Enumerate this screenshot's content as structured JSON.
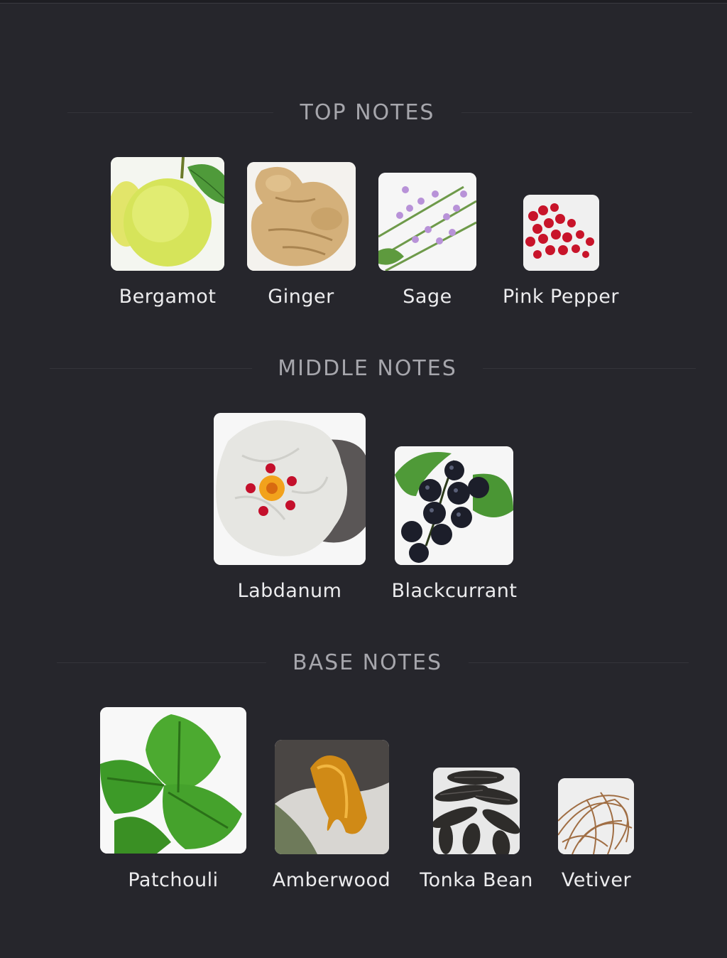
{
  "sections": {
    "top": {
      "title": "TOP NOTES",
      "items": [
        {
          "label": "Bergamot",
          "icon": "bergamot-icon"
        },
        {
          "label": "Ginger",
          "icon": "ginger-icon"
        },
        {
          "label": "Sage",
          "icon": "sage-icon"
        },
        {
          "label": "Pink Pepper",
          "icon": "pink-pepper-icon"
        }
      ]
    },
    "middle": {
      "title": "MIDDLE NOTES",
      "items": [
        {
          "label": "Labdanum",
          "icon": "labdanum-icon"
        },
        {
          "label": "Blackcurrant",
          "icon": "blackcurrant-icon"
        }
      ]
    },
    "base": {
      "title": "BASE NOTES",
      "items": [
        {
          "label": "Patchouli",
          "icon": "patchouli-icon"
        },
        {
          "label": "Amberwood",
          "icon": "amberwood-icon"
        },
        {
          "label": "Tonka Bean",
          "icon": "tonka-bean-icon"
        },
        {
          "label": "Vetiver",
          "icon": "vetiver-icon"
        }
      ]
    }
  },
  "colors": {
    "background": "#26262c",
    "heading": "#a6a6ac",
    "label": "#ececee"
  }
}
